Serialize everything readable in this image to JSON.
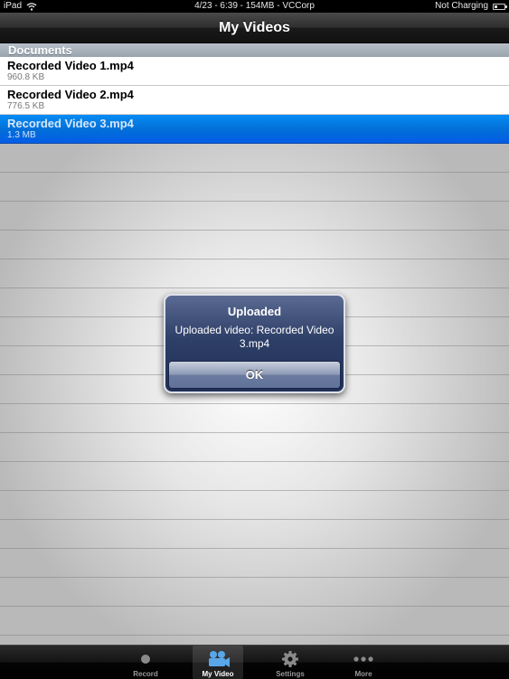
{
  "status_bar": {
    "device": "iPad",
    "center_text": "4/23 - 6:39 - 154MB - VCCorp",
    "charging": "Not Charging"
  },
  "nav": {
    "title": "My Videos"
  },
  "list": {
    "section": "Documents",
    "items": [
      {
        "title": "Recorded Video 1.mp4",
        "size": "960.8 KB",
        "selected": false
      },
      {
        "title": "Recorded Video 2.mp4",
        "size": "776.5 KB",
        "selected": false
      },
      {
        "title": "Recorded Video 3.mp4",
        "size": "1.3 MB",
        "selected": true
      }
    ]
  },
  "alert": {
    "title": "Uploaded",
    "message": "Uploaded video: Recorded Video 3.mp4",
    "ok_label": "OK"
  },
  "tabs": [
    {
      "label": "Record",
      "icon": "record-icon",
      "active": false
    },
    {
      "label": "My Video",
      "icon": "film-camera-icon",
      "active": true
    },
    {
      "label": "Settings",
      "icon": "gear-icon",
      "active": false
    },
    {
      "label": "More",
      "icon": "more-icon",
      "active": false
    }
  ],
  "colors": {
    "selection": "#0370d8",
    "alert_bg": "#2e3f68",
    "active_tab_icon": "#59a7e8"
  }
}
